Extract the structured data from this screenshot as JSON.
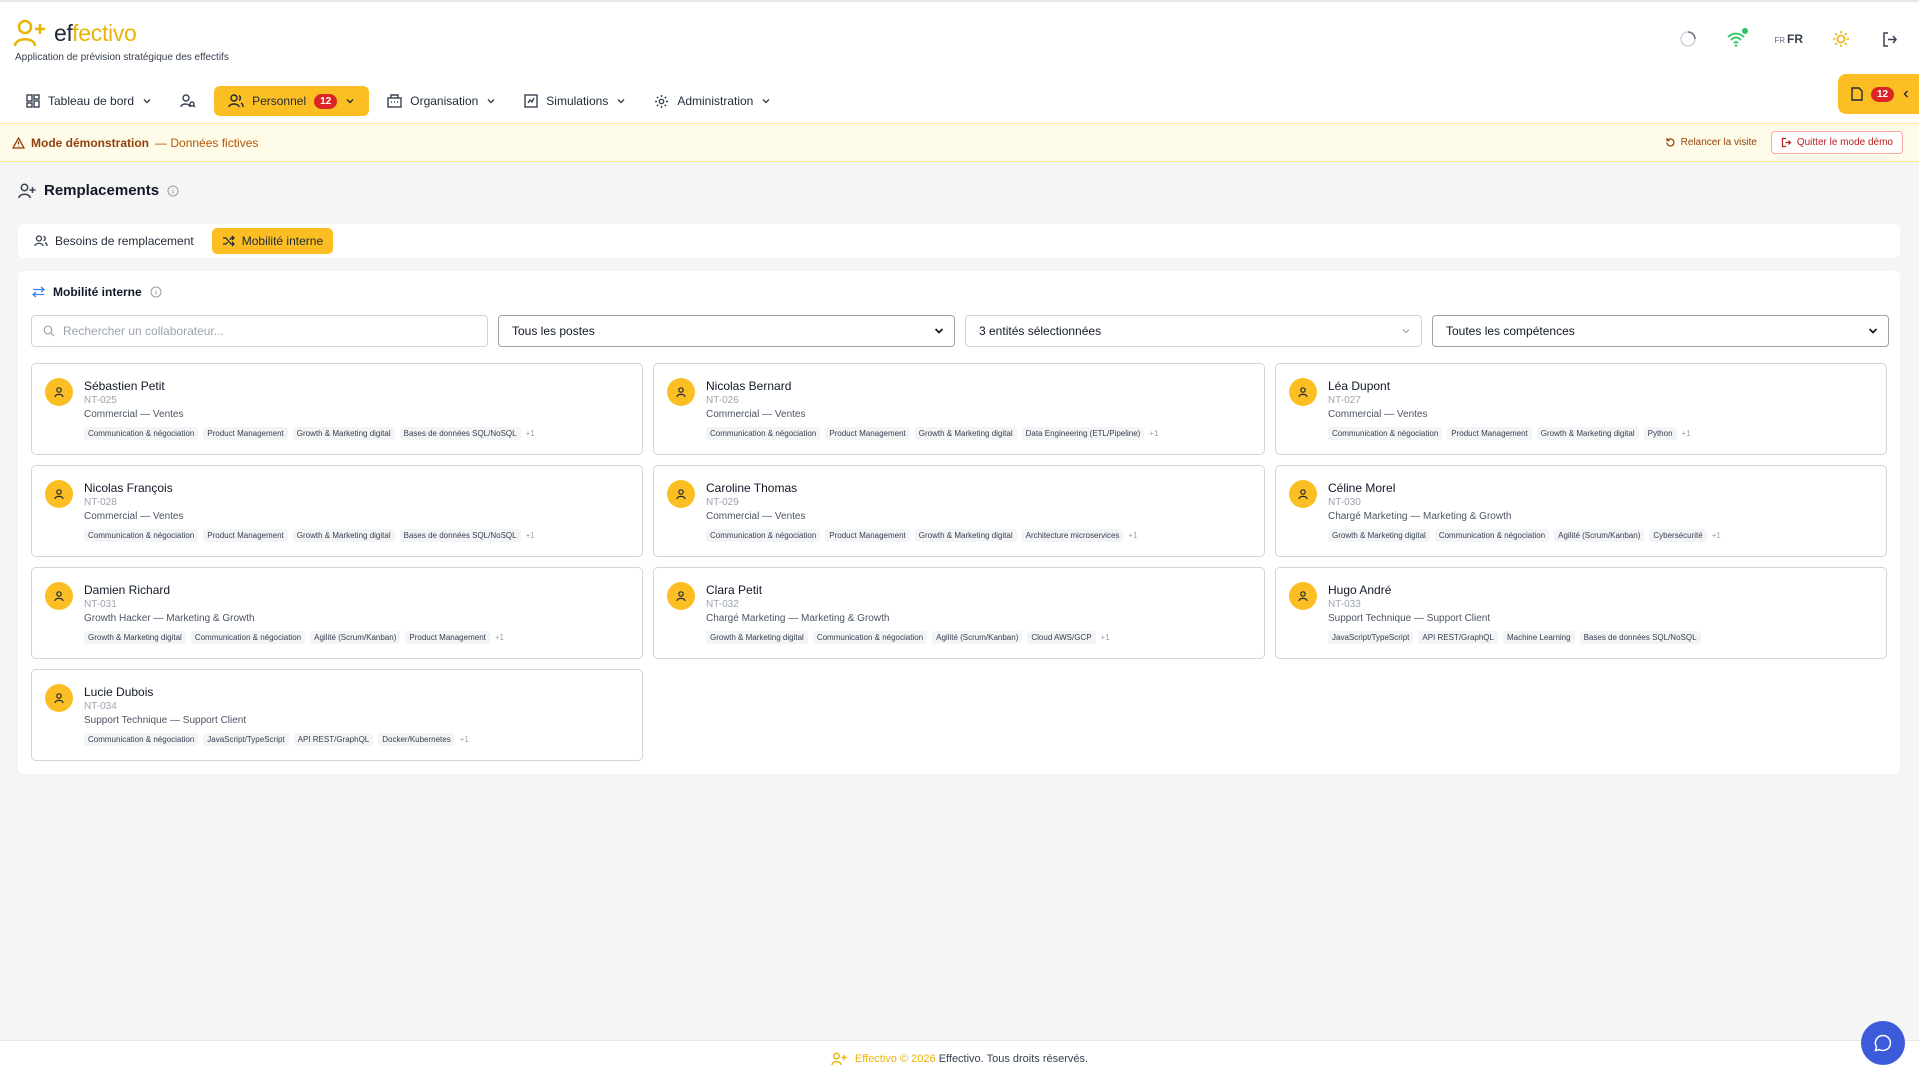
{
  "app": {
    "name_prefix": "ef",
    "name_accent": "fectivo",
    "subtitle": "Application de prévision stratégique des effectifs"
  },
  "header": {
    "lang_small": "FR",
    "lang": "FR"
  },
  "nav": {
    "dashboard": "Tableau de bord",
    "personnel": "Personnel",
    "personnel_badge": "12",
    "organisation": "Organisation",
    "simulations": "Simulations",
    "administration": "Administration"
  },
  "side_tab": {
    "badge": "12"
  },
  "demo": {
    "title": "Mode démonstration",
    "subtitle": "— Données fictives",
    "restart": "Relancer la visite",
    "quit": "Quitter le mode démo"
  },
  "page": {
    "title": "Remplacements",
    "tabs": [
      "Besoins de remplacement",
      "Mobilité interne"
    ],
    "panel_title": "Mobilité interne"
  },
  "filters": {
    "search_placeholder": "Rechercher un collaborateur...",
    "posts": "Tous les postes",
    "entities": "3 entités sélectionnées",
    "skills": "Toutes les compétences"
  },
  "people": [
    {
      "name": "Sébastien Petit",
      "id": "NT-025",
      "role": "Commercial — Ventes",
      "skills": [
        "Communication & négociation",
        "Product Management",
        "Growth & Marketing digital",
        "Bases de données SQL/NoSQL"
      ],
      "more": "+1"
    },
    {
      "name": "Nicolas Bernard",
      "id": "NT-026",
      "role": "Commercial — Ventes",
      "skills": [
        "Communication & négociation",
        "Product Management",
        "Growth & Marketing digital",
        "Data Engineering (ETL/Pipeline)"
      ],
      "more": "+1"
    },
    {
      "name": "Léa Dupont",
      "id": "NT-027",
      "role": "Commercial — Ventes",
      "skills": [
        "Communication & négociation",
        "Product Management",
        "Growth & Marketing digital",
        "Python"
      ],
      "more": "+1"
    },
    {
      "name": "Nicolas François",
      "id": "NT-028",
      "role": "Commercial — Ventes",
      "skills": [
        "Communication & négociation",
        "Product Management",
        "Growth & Marketing digital",
        "Bases de données SQL/NoSQL"
      ],
      "more": "+1"
    },
    {
      "name": "Caroline Thomas",
      "id": "NT-029",
      "role": "Commercial — Ventes",
      "skills": [
        "Communication & négociation",
        "Product Management",
        "Growth & Marketing digital",
        "Architecture microservices"
      ],
      "more": "+1"
    },
    {
      "name": "Céline Morel",
      "id": "NT-030",
      "role": "Chargé Marketing — Marketing & Growth",
      "skills": [
        "Growth & Marketing digital",
        "Communication & négociation",
        "Agilité (Scrum/Kanban)",
        "Cybersécurité"
      ],
      "more": "+1"
    },
    {
      "name": "Damien Richard",
      "id": "NT-031",
      "role": "Growth Hacker — Marketing & Growth",
      "skills": [
        "Growth & Marketing digital",
        "Communication & négociation",
        "Agilité (Scrum/Kanban)",
        "Product Management"
      ],
      "more": "+1"
    },
    {
      "name": "Clara Petit",
      "id": "NT-032",
      "role": "Chargé Marketing — Marketing & Growth",
      "skills": [
        "Growth & Marketing digital",
        "Communication & négociation",
        "Agilité (Scrum/Kanban)",
        "Cloud AWS/GCP"
      ],
      "more": "+1"
    },
    {
      "name": "Hugo André",
      "id": "NT-033",
      "role": "Support Technique — Support Client",
      "skills": [
        "JavaScript/TypeScript",
        "API REST/GraphQL",
        "Machine Learning",
        "Bases de données SQL/NoSQL"
      ],
      "more": ""
    },
    {
      "name": "Lucie Dubois",
      "id": "NT-034",
      "role": "Support Technique — Support Client",
      "skills": [
        "Communication & négociation",
        "JavaScript/TypeScript",
        "API REST/GraphQL",
        "Docker/Kubernetes"
      ],
      "more": "+1"
    }
  ],
  "footer": {
    "brand": "Effectivo",
    "copyright": "© 2026",
    "rights": "Effectivo. Tous droits réservés."
  },
  "colors": {
    "accent": "#fbbf24",
    "badge": "#dc2626",
    "chat": "#3b5bdb"
  }
}
